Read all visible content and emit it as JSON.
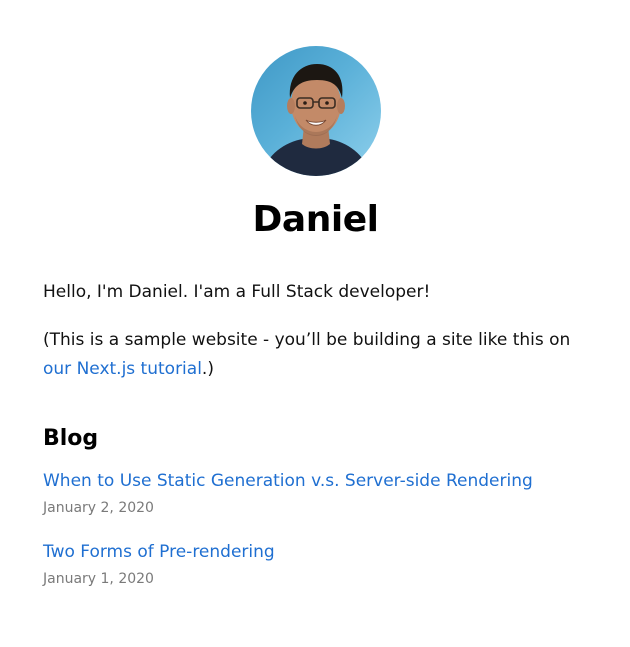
{
  "profile": {
    "name": "Daniel"
  },
  "intro": {
    "greeting": "Hello, I'm Daniel. I'am a Full Stack developer!",
    "note_prefix": "(This is a sample website - you’ll be building a site like this on ",
    "note_link": "our Next.js tutorial",
    "note_suffix": ".)"
  },
  "blog": {
    "heading": "Blog",
    "posts": [
      {
        "title": "When to Use Static Generation v.s. Server-side Rendering",
        "date": "January 2, 2020"
      },
      {
        "title": "Two Forms of Pre-rendering",
        "date": "January 1, 2020"
      }
    ]
  },
  "colors": {
    "link": "#1f6fd1",
    "date": "#7a7a7a",
    "avatar_background": "#5ab0d8"
  }
}
